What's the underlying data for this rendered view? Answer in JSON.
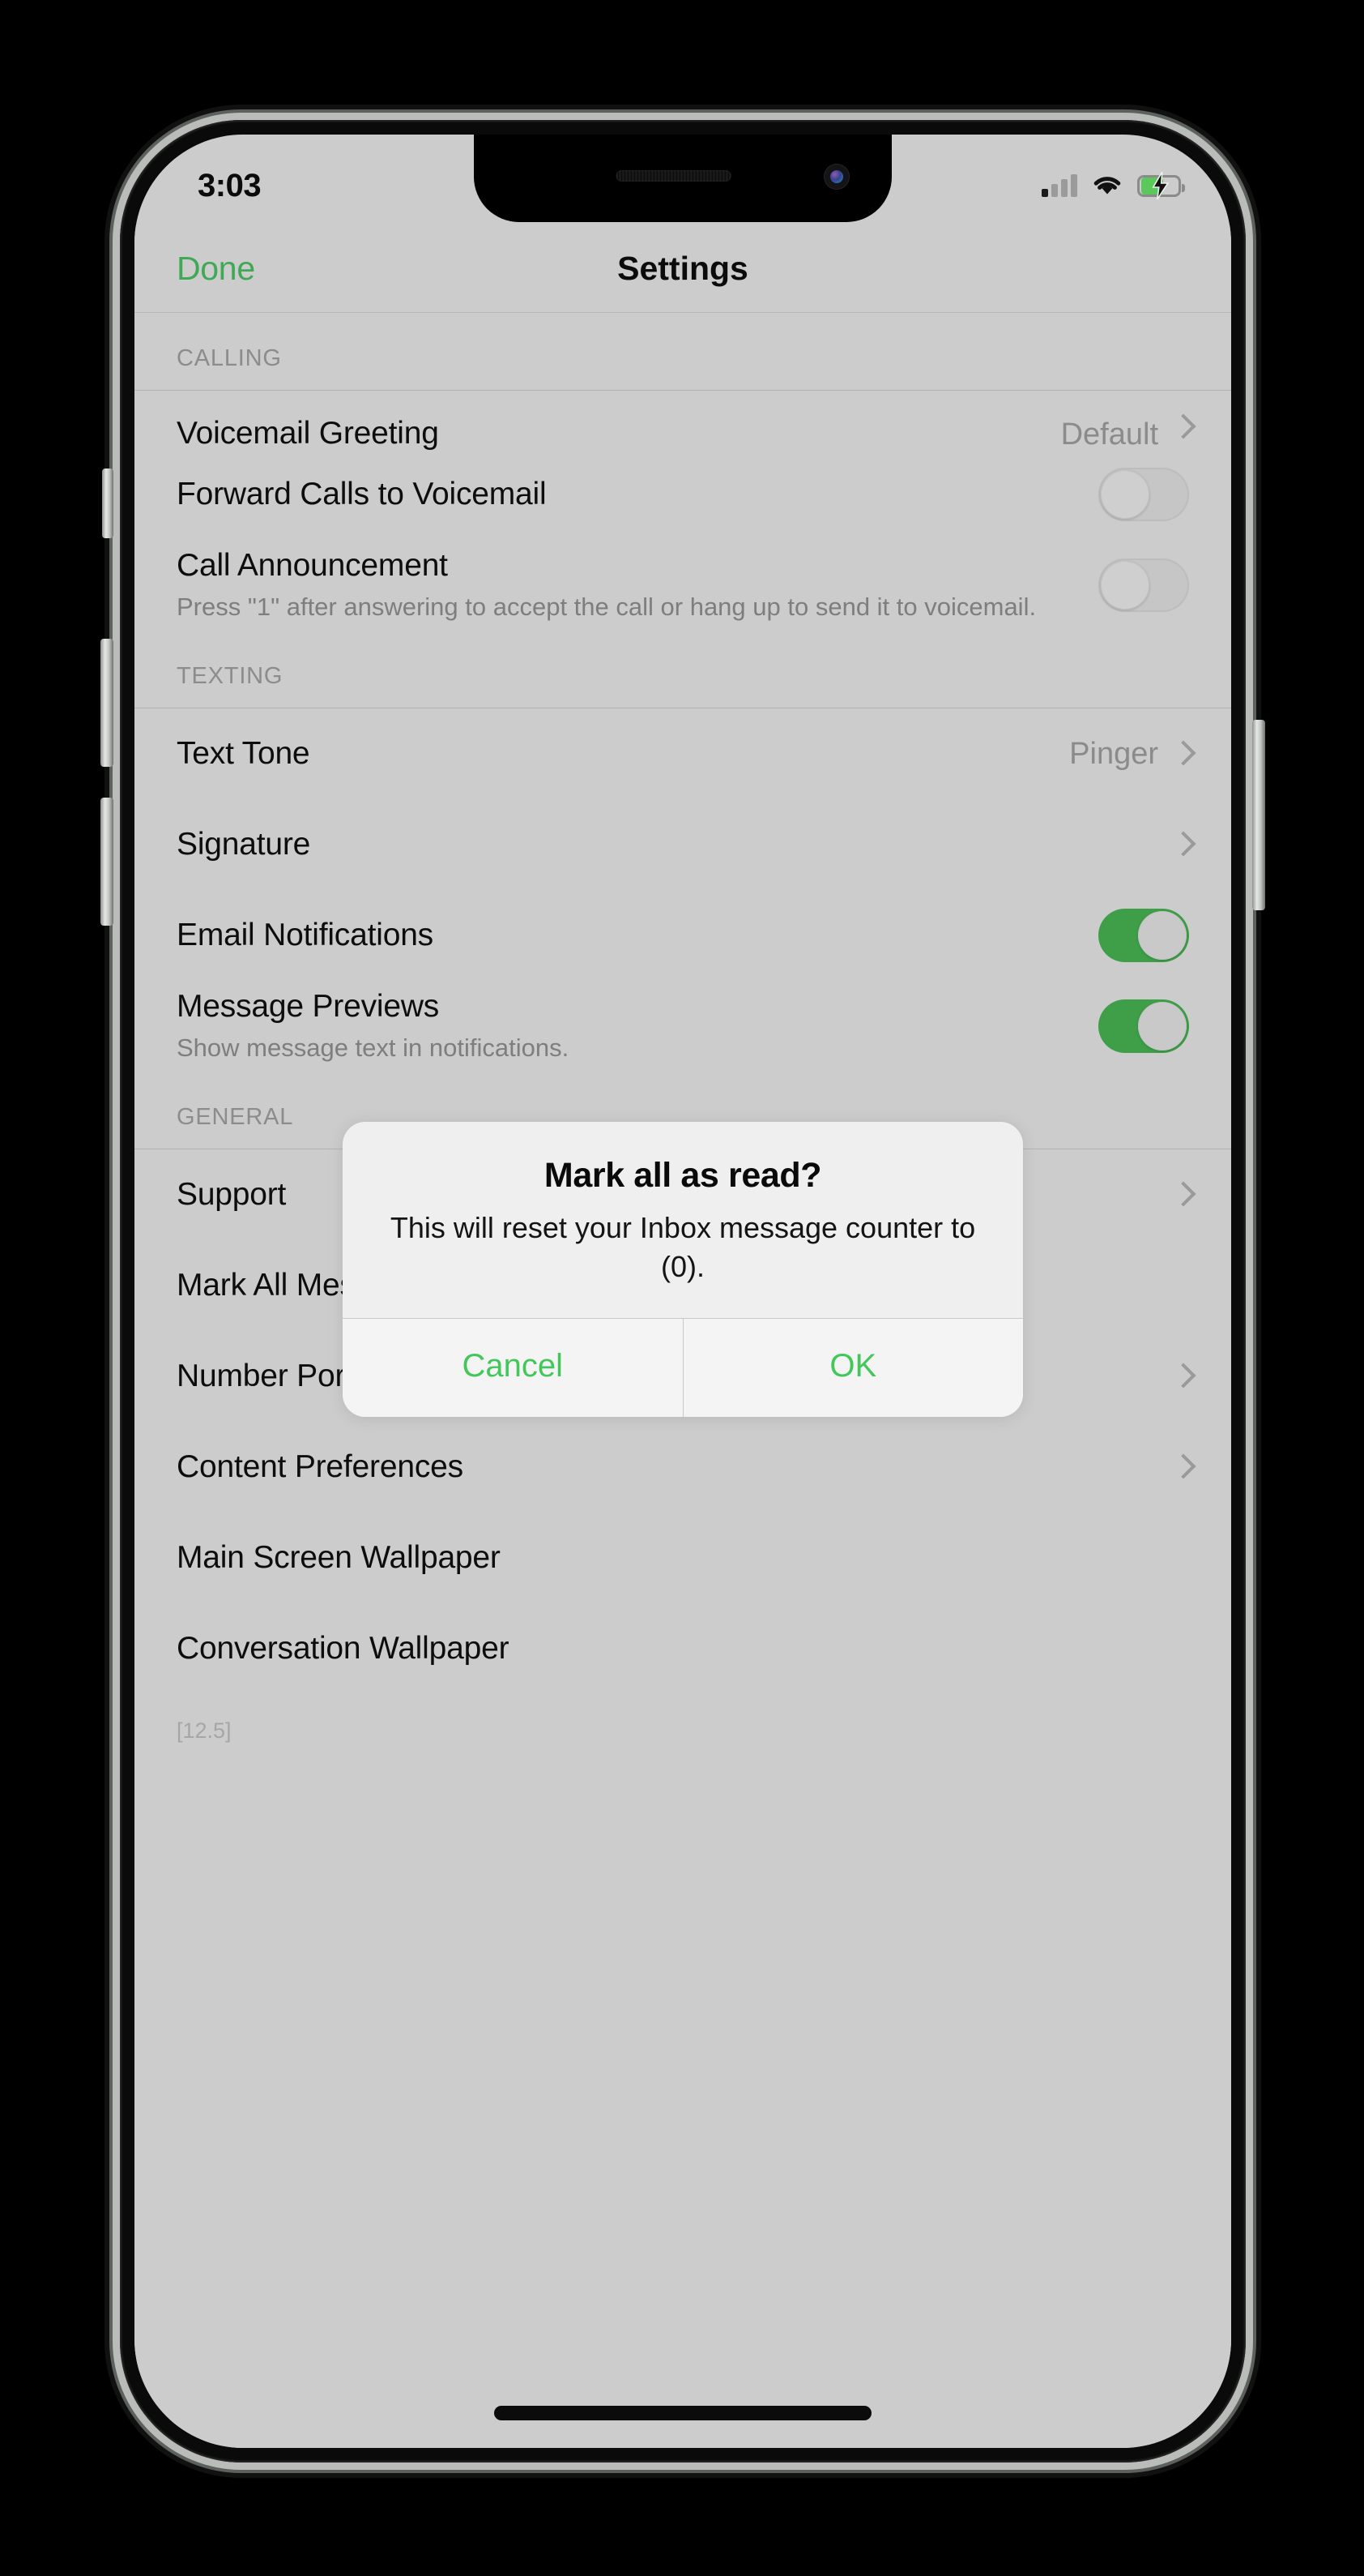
{
  "status_bar": {
    "time": "3:03",
    "signal_icon": "cellular-signal-icon",
    "wifi_icon": "wifi-icon",
    "battery_icon": "battery-charging-icon",
    "battery_level_percent": 56,
    "battery_charging": true
  },
  "nav_bar": {
    "left_button": "Done",
    "title": "Settings"
  },
  "colors": {
    "accent_green": "#3fa955",
    "toggle_on": "#3e9f48",
    "alert_button_green": "#43c75a",
    "screen_background": "#cccccc",
    "alert_background": "#efefef"
  },
  "sections": [
    {
      "header": "CALLING",
      "rows": [
        {
          "label": "Voicemail Greeting",
          "value": "Default",
          "accessory": "chevron",
          "clipped": true
        },
        {
          "label": "Forward Calls to Voicemail",
          "accessory": "toggle",
          "toggle_on": false
        },
        {
          "label": "Call Announcement",
          "subtitle": "Press \"1\" after answering to accept the call or hang up to send it to voicemail.",
          "accessory": "toggle",
          "toggle_on": false
        }
      ]
    },
    {
      "header": "TEXTING",
      "rows": [
        {
          "label": "Text Tone",
          "value": "Pinger",
          "accessory": "chevron"
        },
        {
          "label": "Signature",
          "accessory": "chevron"
        },
        {
          "label": "Email Notifications",
          "accessory": "toggle",
          "toggle_on": true
        },
        {
          "label": "Message Previews",
          "subtitle": "Show message text in notifications.",
          "accessory": "toggle",
          "toggle_on": true
        }
      ]
    },
    {
      "header": "GENERAL",
      "rows": [
        {
          "label": "Support",
          "accessory": "chevron"
        },
        {
          "label": "Mark All Messages as Read",
          "accessory": "none"
        },
        {
          "label": "Number Porting",
          "accessory": "chevron"
        },
        {
          "label": "Content Preferences",
          "accessory": "chevron"
        },
        {
          "label": "Main Screen Wallpaper",
          "accessory": "none"
        },
        {
          "label": "Conversation Wallpaper",
          "accessory": "none"
        }
      ]
    }
  ],
  "version": "[12.5]",
  "alert": {
    "title": "Mark all as read?",
    "message": "This will reset your Inbox message counter to (0).",
    "cancel_label": "Cancel",
    "confirm_label": "OK"
  }
}
